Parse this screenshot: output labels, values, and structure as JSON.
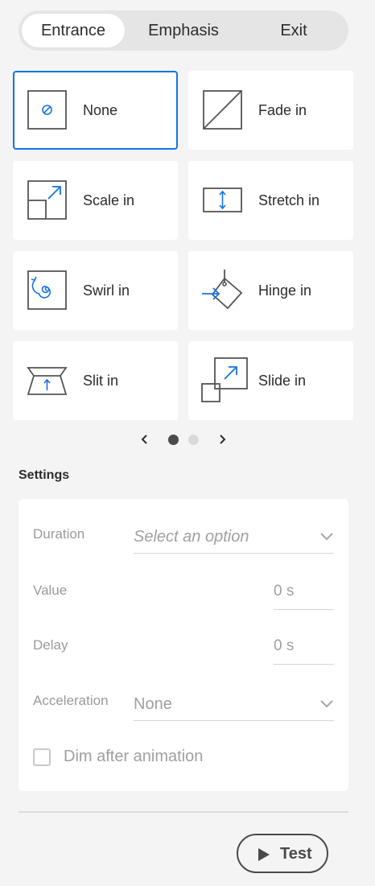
{
  "tabs": [
    {
      "label": "Entrance",
      "active": true
    },
    {
      "label": "Emphasis",
      "active": false
    },
    {
      "label": "Exit",
      "active": false
    }
  ],
  "animations": [
    {
      "label": "None",
      "icon": "none-icon",
      "selected": true
    },
    {
      "label": "Fade in",
      "icon": "fade-in-icon",
      "selected": false
    },
    {
      "label": "Scale in",
      "icon": "scale-in-icon",
      "selected": false
    },
    {
      "label": "Stretch in",
      "icon": "stretch-in-icon",
      "selected": false
    },
    {
      "label": "Swirl in",
      "icon": "swirl-in-icon",
      "selected": false
    },
    {
      "label": "Hinge in",
      "icon": "hinge-in-icon",
      "selected": false
    },
    {
      "label": "Slit in",
      "icon": "slit-in-icon",
      "selected": false
    },
    {
      "label": "Slide in",
      "icon": "slide-in-icon",
      "selected": false
    }
  ],
  "pager": {
    "pages": 2,
    "current": 1
  },
  "settings": {
    "heading": "Settings",
    "duration": {
      "label": "Duration",
      "placeholder": "Select an option"
    },
    "value": {
      "label": "Value",
      "value": "0 s"
    },
    "delay": {
      "label": "Delay",
      "value": "0 s"
    },
    "acceleration": {
      "label": "Acceleration",
      "value": "None"
    },
    "dim": {
      "label": "Dim after animation",
      "checked": false
    }
  },
  "test_button": {
    "label": "Test"
  },
  "colors": {
    "accent": "#1473e6",
    "icon_gray": "#555555"
  }
}
